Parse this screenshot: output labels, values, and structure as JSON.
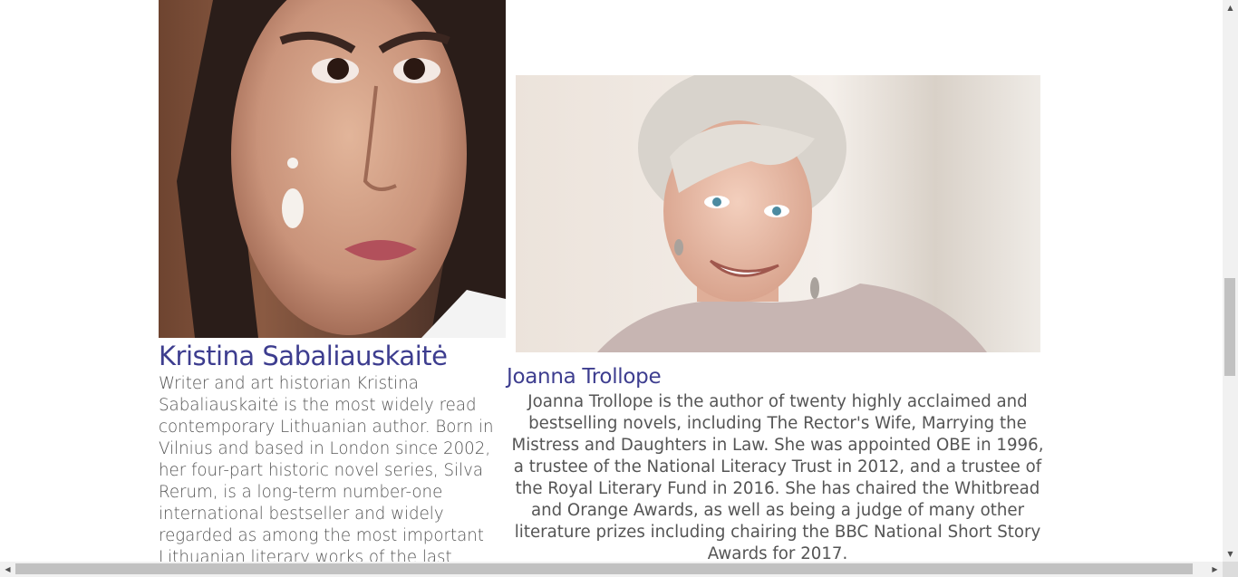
{
  "speakers": [
    {
      "name": "Kristina Sabaliauskaitė",
      "bio": "Writer and art historian Kristina Sabaliauskaitė is the most widely read contemporary Lithuanian author. Born in Vilnius and based in London since 2002, her four-part historic novel series, Silva Rerum, is a long-term number-one international bestseller and widely regarded as among the most important Lithuanian literary works of the last",
      "photo_icon": "portrait-photo"
    },
    {
      "name": "Joanna Trollope",
      "bio": "Joanna Trollope is the author of twenty highly acclaimed and bestselling novels, including The Rector's Wife, Marrying the Mistress and Daughters in Law. She was appointed OBE in 1996, a trustee of the National Literacy Trust in 2012, and a trustee of the Royal Literary Fund in 2016. She has chaired the Whitbread and Orange Awards, as well as being a judge of many other literature prizes including chairing the BBC National Short Story Awards for 2017.",
      "photo_icon": "portrait-photo"
    }
  ],
  "colors": {
    "name_color": "#3d3d8f",
    "text_color": "#555555"
  },
  "scrollbar": {
    "up": "▲",
    "down": "▼",
    "left": "◀",
    "right": "▶"
  }
}
